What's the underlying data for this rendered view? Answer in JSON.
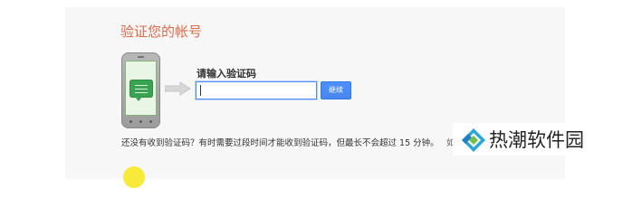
{
  "header": {
    "title": "验证您的帐号"
  },
  "verification": {
    "input_label": "请输入验证码",
    "input_value": "",
    "continue_label": "继续"
  },
  "help": {
    "text": "还没有收到验证码？有时需要过段时间才能收到验证码，但最长不会超过 15 分钟。",
    "obscured_text": "如果..."
  },
  "watermark": {
    "text": "热潮软件园"
  },
  "icons": {
    "phone": "phone-icon",
    "message": "message-icon",
    "arrow": "arrow-right-icon",
    "watermark_logo": "diamond-logo-icon"
  },
  "colors": {
    "title": "#dd6a4a",
    "primary_button": "#4d90fe",
    "panel_background": "#f7f7f7",
    "phone_message": "#3aa351",
    "yellow_decoration": "#f7ea3b"
  }
}
